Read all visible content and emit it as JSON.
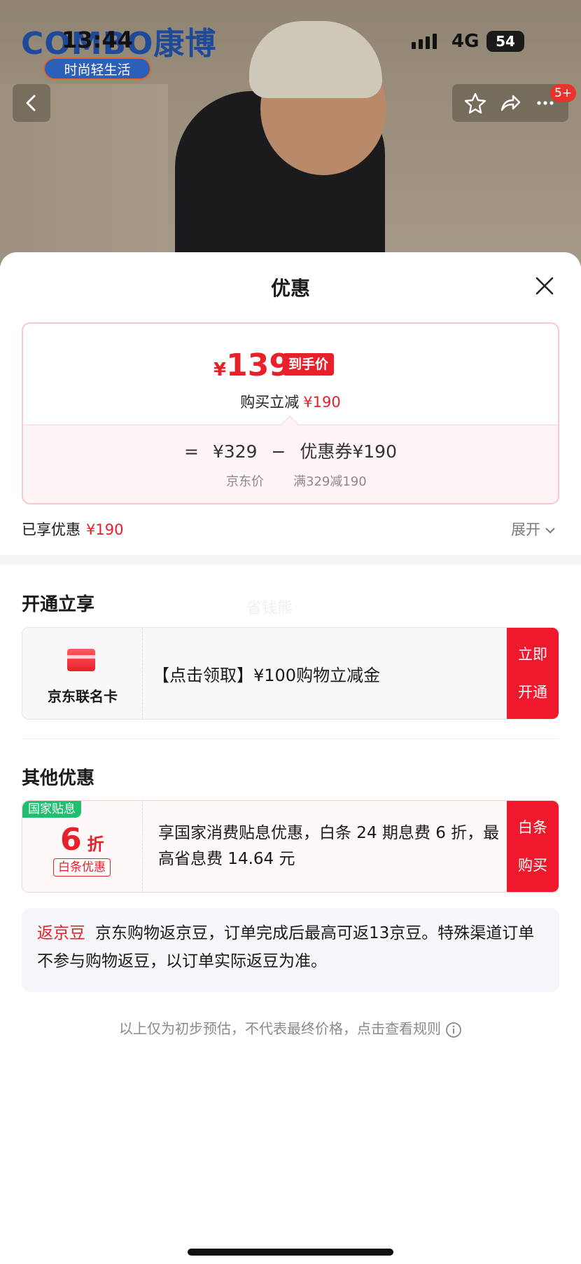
{
  "status_bar": {
    "time": "13:44",
    "network": "4G",
    "battery": "54"
  },
  "backdrop": {
    "brand_logo": "COMBO康博",
    "brand_tagline": "时尚轻生活",
    "message_badge": "5+"
  },
  "sheet": {
    "title": "优惠",
    "price_summary": {
      "currency": "¥",
      "final_price": "139",
      "final_price_tag": "到手价",
      "reduce_label": "购买立减",
      "reduce_amount": "¥190",
      "calc_equals": "=",
      "calc_base": "¥329",
      "calc_minus": "−",
      "calc_coupon": "优惠券¥190",
      "calc_base_label": "京东价",
      "calc_coupon_label": "满329减190"
    },
    "enjoyed": {
      "label": "已享优惠",
      "amount": "¥190",
      "expand_label": "展开"
    },
    "open_section": {
      "title": "开通立享",
      "watermark": "省钱熊",
      "card_label": "京东联名卡",
      "offer_text": "【点击领取】¥100购物立减金",
      "button_line1": "立即",
      "button_line2": "开通"
    },
    "other_section": {
      "title": "其他优惠",
      "tag": "国家贴息",
      "discount_value": "6",
      "discount_unit": "折",
      "baitiao_tag": "白条优惠",
      "offer_text": "享国家消费贴息优惠，白条 24 期息费 6 折，最高省息费 14.64 元",
      "button_line1": "白条",
      "button_line2": "购买"
    },
    "jingdou": {
      "tag": "返京豆",
      "text": "京东购物返京豆，订单完成后最高可返13京豆。特殊渠道订单不参与购物返豆，以订单实际返豆为准。"
    },
    "footnote": "以上仅为初步预估，不代表最终价格，点击查看规则"
  },
  "colors": {
    "accent_red": "#e8202a",
    "gov_green": "#1fbf6f",
    "button_red": "#f0182c"
  }
}
